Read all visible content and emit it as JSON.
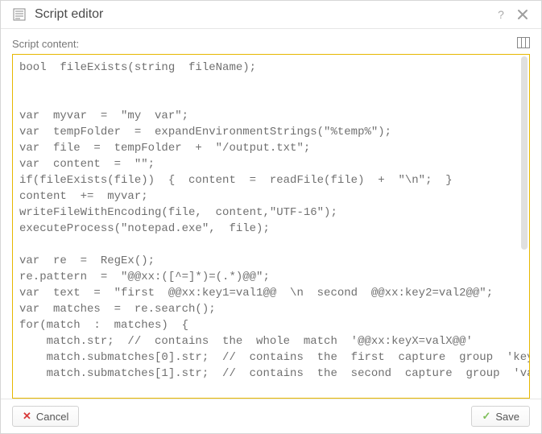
{
  "dialog": {
    "title": "Script editor"
  },
  "field": {
    "label": "Script content:"
  },
  "editor": {
    "content": "bool  fileExists(string  fileName);\n\n\nvar  myvar  =  \"my  var\";\nvar  tempFolder  =  expandEnvironmentStrings(\"%temp%\");\nvar  file  =  tempFolder  +  \"/output.txt\";\nvar  content  =  \"\";\nif(fileExists(file))  {  content  =  readFile(file)  +  \"\\n\";  }\ncontent  +=  myvar;\nwriteFileWithEncoding(file,  content,\"UTF-16\");\nexecuteProcess(\"notepad.exe\",  file);\n\nvar  re  =  RegEx();\nre.pattern  =  \"@@xx:([^=]*)=(.*)@@\";\nvar  text  =  \"first  @@xx:key1=val1@@  \\n  second  @@xx:key2=val2@@\";\nvar  matches  =  re.search();\nfor(match  :  matches)  {\n    match.str;  //  contains  the  whole  match  '@@xx:keyX=valX@@'\n    match.submatches[0].str;  //  contains  the  first  capture  group  'keyX'\n    match.submatches[1].str;  //  contains  the  second  capture  group  'valX'"
  },
  "buttons": {
    "cancel": "Cancel",
    "save": "Save"
  }
}
